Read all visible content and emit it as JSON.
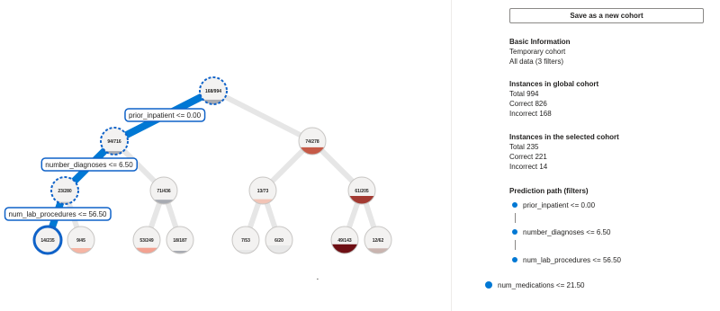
{
  "colors": {
    "accent": "#0078d4",
    "edge": "#e6e6e6",
    "node_border": "#c8c6c4",
    "selected": "#0f62c8"
  },
  "tree": {
    "nodes": [
      {
        "id": "n0",
        "label": "168/994",
        "error_rate": 0.17,
        "fill": "#a8abb2",
        "selected": true,
        "on_path": true
      },
      {
        "id": "n1",
        "label": "94/716",
        "error_rate": 0.13,
        "fill": "#a8abb2",
        "selected": true,
        "on_path": true
      },
      {
        "id": "n2",
        "label": "74/278",
        "error_rate": 0.27,
        "fill": "#c65a47",
        "selected": false,
        "on_path": false
      },
      {
        "id": "n3",
        "label": "23/280",
        "error_rate": 0.08,
        "fill": "#c8c6c4",
        "selected": true,
        "on_path": true
      },
      {
        "id": "n4",
        "label": "71/436",
        "error_rate": 0.16,
        "fill": "#a8abb2",
        "selected": false,
        "on_path": false
      },
      {
        "id": "n5",
        "label": "13/73",
        "error_rate": 0.18,
        "fill": "#f2c4b6",
        "selected": false,
        "on_path": false
      },
      {
        "id": "n6",
        "label": "61/205",
        "error_rate": 0.3,
        "fill": "#a33a32",
        "selected": false,
        "on_path": false
      },
      {
        "id": "n7",
        "label": "14/235",
        "error_rate": 0.06,
        "fill": "#e8e8e8",
        "selected": true,
        "on_path": true
      },
      {
        "id": "n8",
        "label": "9/45",
        "error_rate": 0.2,
        "fill": "#f5b5a4",
        "selected": false,
        "on_path": false
      },
      {
        "id": "n9",
        "label": "53/249",
        "error_rate": 0.21,
        "fill": "#f3a291",
        "selected": false,
        "on_path": false
      },
      {
        "id": "n10",
        "label": "18/187",
        "error_rate": 0.1,
        "fill": "#a8abb2",
        "selected": false,
        "on_path": false
      },
      {
        "id": "n11",
        "label": "7/53",
        "error_rate": 0.13,
        "fill": "#e8e8e8",
        "selected": false,
        "on_path": false
      },
      {
        "id": "n12",
        "label": "6/20",
        "error_rate": 0.3,
        "fill": "#e8e8e8",
        "selected": false,
        "on_path": false
      },
      {
        "id": "n13",
        "label": "49/143",
        "error_rate": 0.34,
        "fill": "#6e0f14",
        "selected": false,
        "on_path": false
      },
      {
        "id": "n14",
        "label": "12/62",
        "error_rate": 0.19,
        "fill": "#c9b4af",
        "selected": false,
        "on_path": false
      }
    ],
    "edges": [
      {
        "from": "n0",
        "to": "n1"
      },
      {
        "from": "n0",
        "to": "n2"
      },
      {
        "from": "n1",
        "to": "n3"
      },
      {
        "from": "n1",
        "to": "n4"
      },
      {
        "from": "n2",
        "to": "n5"
      },
      {
        "from": "n2",
        "to": "n6"
      },
      {
        "from": "n3",
        "to": "n7"
      },
      {
        "from": "n3",
        "to": "n8"
      },
      {
        "from": "n4",
        "to": "n9"
      },
      {
        "from": "n4",
        "to": "n10"
      },
      {
        "from": "n5",
        "to": "n11"
      },
      {
        "from": "n5",
        "to": "n12"
      },
      {
        "from": "n6",
        "to": "n13"
      },
      {
        "from": "n6",
        "to": "n14"
      }
    ],
    "filter_labels": [
      {
        "edge_to": "n1",
        "text": "prior_inpatient <= 0.00"
      },
      {
        "edge_to": "n3",
        "text": "number_diagnoses <= 6.50"
      },
      {
        "edge_to": "n7",
        "text": "num_lab_procedures <= 56.50"
      }
    ]
  },
  "panel": {
    "save_button": "Save as a new cohort",
    "basic_info": {
      "title": "Basic Information",
      "line1": "Temporary cohort",
      "line2": "All data (3 filters)"
    },
    "global_cohort": {
      "title": "Instances in global cohort",
      "total": "Total 994",
      "correct": "Correct 826",
      "incorrect": "Incorrect 168"
    },
    "selected_cohort": {
      "title": "Instances in the selected cohort",
      "total": "Total 235",
      "correct": "Correct 221",
      "incorrect": "Incorrect 14"
    },
    "prediction_path": {
      "title": "Prediction path (filters)",
      "items": [
        "prior_inpatient <= 0.00",
        "number_diagnoses <= 6.50",
        "num_lab_procedures <= 56.50",
        "num_medications <= 21.50"
      ]
    }
  }
}
